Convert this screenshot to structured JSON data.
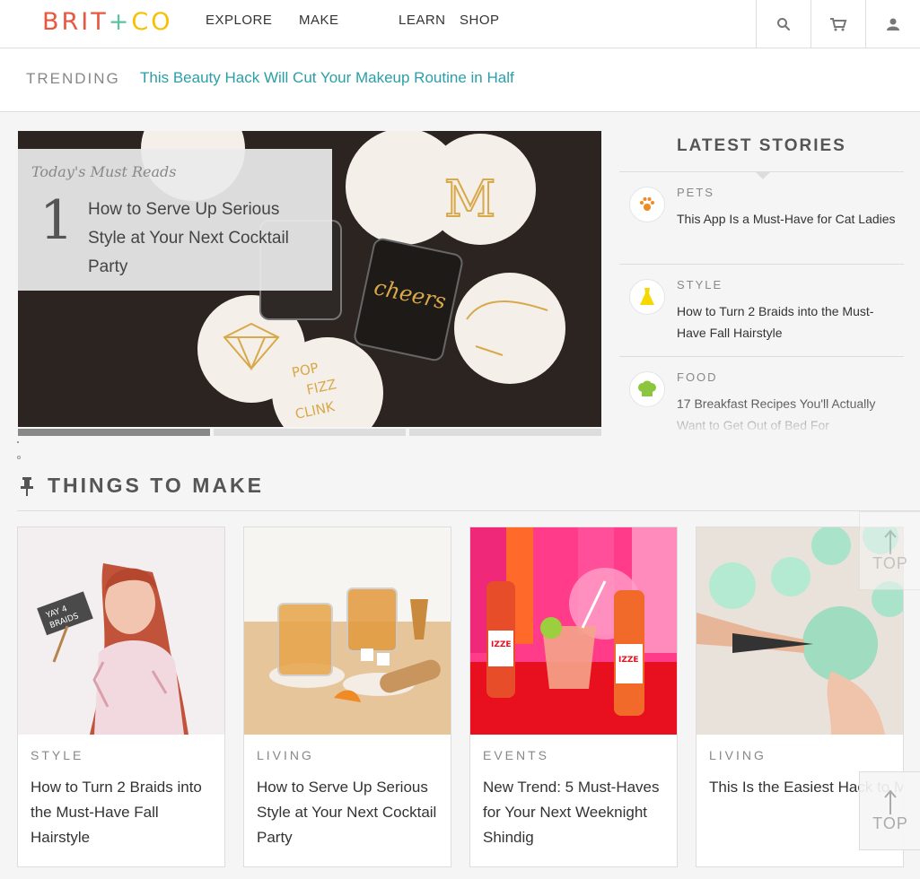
{
  "header": {
    "logo_left": "BRIT",
    "logo_plus": "+",
    "logo_right": "CO",
    "nav": [
      {
        "label": "EXPLORE"
      },
      {
        "label": "MAKE"
      },
      {
        "label": "LEARN"
      },
      {
        "label": "SHOP"
      }
    ],
    "icons": [
      "search-icon",
      "cart-icon",
      "user-icon"
    ]
  },
  "trending": {
    "label": "TRENDING",
    "link": "This Beauty Hack Will Cut Your Makeup Routine in Half"
  },
  "hero": {
    "kicker": "Today's Must Reads",
    "number": "1",
    "title": "How to Serve Up Serious Style at Your Next Cocktail Party",
    "coaster_text": [
      "M",
      "cheers",
      "POP",
      "FIZZ",
      "CLINK"
    ],
    "slides": 3,
    "active_slide": 1
  },
  "latest": {
    "title": "LATEST STORIES",
    "stories": [
      {
        "category": "PETS",
        "title": "This App Is a Must-Have for Cat Ladies",
        "icon": "paw-icon",
        "color": "#f08a24"
      },
      {
        "category": "STYLE",
        "title": "How to Turn 2 Braids into the Must-Have Fall Hairstyle",
        "icon": "dress-icon",
        "color": "#f6d800"
      },
      {
        "category": "FOOD",
        "title": "17 Breakfast Recipes You'll Actually Want to Get Out of Bed For",
        "icon": "chef-hat-icon",
        "color": "#8cc63f"
      }
    ]
  },
  "things_to_make": {
    "title": "THINGS TO MAKE",
    "cards": [
      {
        "category": "STYLE",
        "title": "How to Turn 2 Braids into the Must-Have Fall Hairstyle",
        "sign": [
          "YAY 4",
          "BRAIDS"
        ]
      },
      {
        "category": "LIVING",
        "title": "How to Serve Up Serious Style at Your Next Cocktail Party"
      },
      {
        "category": "EVENTS",
        "title": "New Trend: 5 Must-Haves for Your Next Weeknight Shindig",
        "bottle_label": "IZZE"
      },
      {
        "category": "LIVING",
        "title": "This Is the Easiest Hack to Make Pom Poms Ever"
      }
    ]
  },
  "top_button": {
    "label": "TOP"
  }
}
